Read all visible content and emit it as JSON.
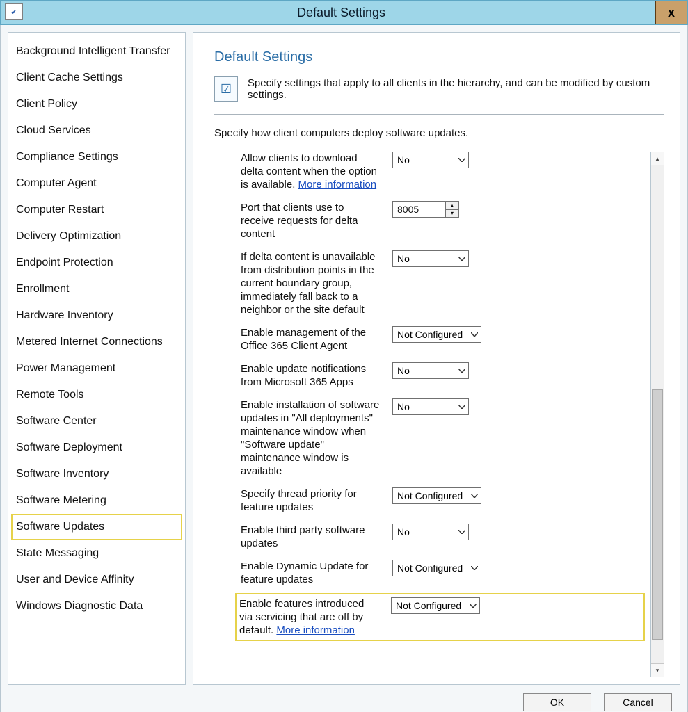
{
  "title": "Default Settings",
  "close_glyph": "x",
  "sidebar": {
    "items": [
      "Background Intelligent Transfer",
      "Client Cache Settings",
      "Client Policy",
      "Cloud Services",
      "Compliance Settings",
      "Computer Agent",
      "Computer Restart",
      "Delivery Optimization",
      "Endpoint Protection",
      "Enrollment",
      "Hardware Inventory",
      "Metered Internet Connections",
      "Power Management",
      "Remote Tools",
      "Software Center",
      "Software Deployment",
      "Software Inventory",
      "Software Metering",
      "Software Updates",
      "State Messaging",
      "User and Device Affinity",
      "Windows Diagnostic Data"
    ],
    "selected_index": 18
  },
  "main": {
    "header": "Default Settings",
    "intro": "Specify settings that apply to all clients in the hierarchy, and can be modified by custom settings.",
    "section_intro": "Specify how client computers deploy software updates.",
    "link_text": "More information"
  },
  "settings": [
    {
      "label_pre": "Allow clients to download delta content when the option is available. ",
      "has_link": true,
      "control": "select",
      "value": "No"
    },
    {
      "label_pre": "Port that clients use to receive requests for delta content",
      "has_link": false,
      "control": "spin",
      "value": "8005"
    },
    {
      "label_pre": "If delta content is unavailable from distribution points in the current boundary group, immediately fall back to a neighbor or the site default",
      "has_link": false,
      "control": "select",
      "value": "No"
    },
    {
      "label_pre": "Enable management of the Office 365 Client Agent",
      "has_link": false,
      "control": "select-wide",
      "value": "Not Configured"
    },
    {
      "label_pre": "Enable update notifications from Microsoft 365 Apps",
      "has_link": false,
      "control": "select",
      "value": "No"
    },
    {
      "label_pre": "Enable installation of software updates in \"All deployments\" maintenance window when \"Software update\" maintenance window is available",
      "has_link": false,
      "control": "select",
      "value": "No"
    },
    {
      "label_pre": "Specify thread priority for feature updates",
      "has_link": false,
      "control": "select-wide",
      "value": "Not Configured"
    },
    {
      "label_pre": "Enable third party software updates",
      "has_link": false,
      "control": "select",
      "value": "No"
    },
    {
      "label_pre": "Enable Dynamic Update for feature updates",
      "has_link": false,
      "control": "select-wide",
      "value": "Not Configured"
    },
    {
      "label_pre": "Enable features introduced via servicing that are off by default. ",
      "has_link": true,
      "control": "select-wide",
      "value": "Not Configured",
      "highlight": true
    }
  ],
  "footer": {
    "ok": "OK",
    "cancel": "Cancel"
  }
}
